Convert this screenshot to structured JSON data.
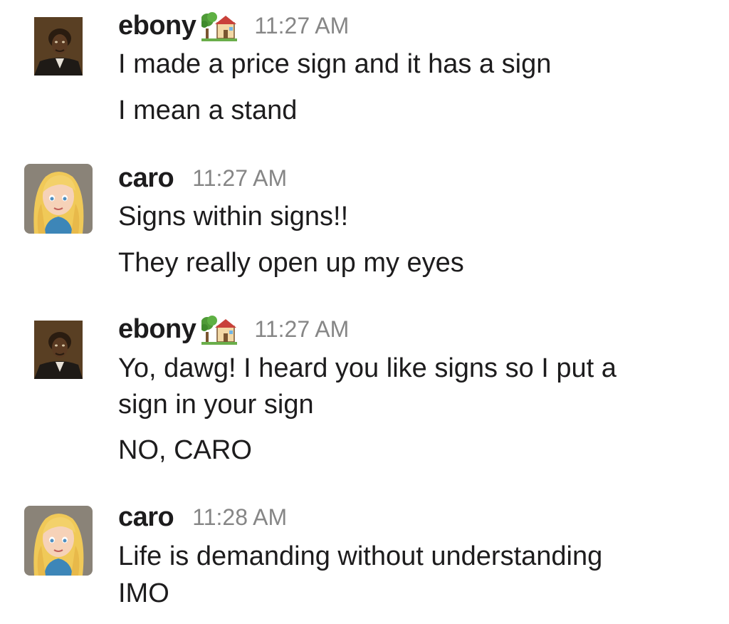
{
  "messages": [
    {
      "author": "ebony",
      "status_icon": "house-with-garden-icon",
      "time": "11:27 AM",
      "lines": [
        "I made a price sign and it has a sign",
        "I mean a stand"
      ]
    },
    {
      "author": "caro",
      "time": "11:27 AM",
      "lines": [
        "Signs within signs!!",
        "They really open up my eyes"
      ]
    },
    {
      "author": "ebony",
      "status_icon": "house-with-garden-icon",
      "time": "11:27 AM",
      "lines": [
        "Yo, dawg! I heard you like signs so I put a",
        "sign in your sign",
        "NO, CARO"
      ]
    },
    {
      "author": "caro",
      "time": "11:28 AM",
      "lines": [
        "Life is demanding without understanding",
        "IMO"
      ]
    }
  ],
  "colors": {
    "text": "#1d1c1d",
    "timestamp": "#868686",
    "background": "#ffffff"
  }
}
